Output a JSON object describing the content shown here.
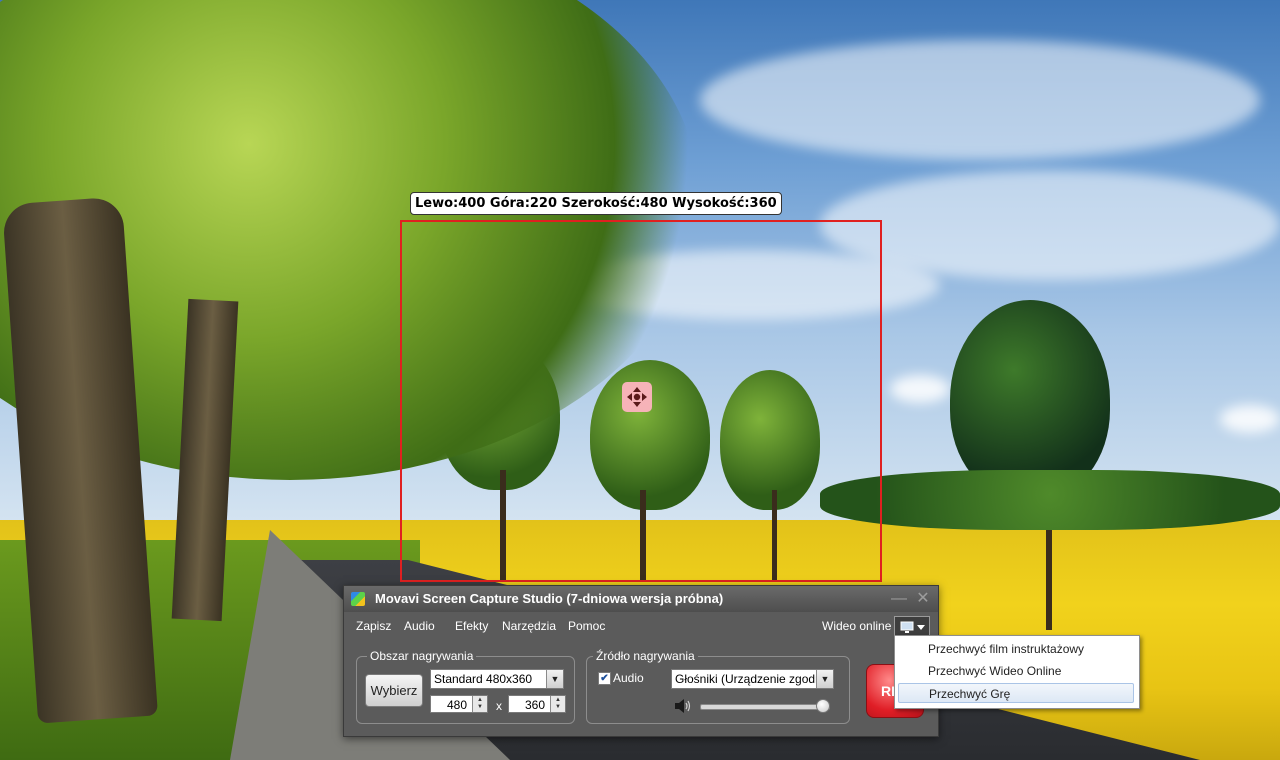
{
  "capture": {
    "coords_text": "Lewo:400 Góra:220 Szerokość:480 Wysokość:360"
  },
  "app": {
    "title": "Movavi Screen Capture Studio   (7-dniowa wersja próbna)",
    "menu": [
      "Zapisz",
      "Audio",
      "Efekty",
      "Narzędzia",
      "Pomoc"
    ],
    "online_label": "Wideo online",
    "area_group": {
      "title": "Obszar nagrywania",
      "select_button": "Wybierz",
      "preset": "Standard 480x360",
      "width": "480",
      "height": "360",
      "separator": "x"
    },
    "source_group": {
      "title": "Źródło nagrywania",
      "audio_label": "Audio",
      "audio_checked": true,
      "device": "Głośniki (Urządzenie zgodne z",
      "volume_fraction": 0.95
    },
    "record_button": "REC"
  },
  "dropdown": {
    "items": [
      "Przechwyć film instruktażowy",
      "Przechwyć Wideo Online",
      "Przechwyć Grę"
    ],
    "selected_index": 2
  },
  "colors": {
    "capture_border": "#e02020",
    "app_bg": "#5b5b5b",
    "record": "#e01e26"
  }
}
